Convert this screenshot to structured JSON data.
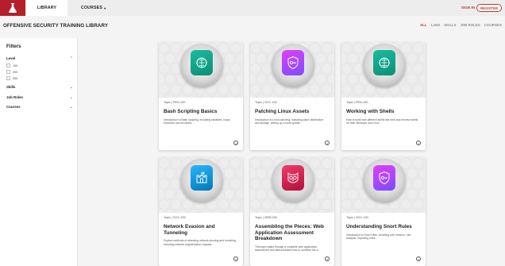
{
  "nav": {
    "library": "LIBRARY",
    "courses": "COURSES",
    "caret": "▾",
    "signin": "SIGN IN",
    "register": "REGISTER"
  },
  "page": {
    "title": "OFFENSIVE SECURITY TRAINING LIBRARY",
    "tabs": [
      "ALL",
      "LABS",
      "SKILLS",
      "JOB ROLES",
      "COURSES"
    ],
    "active_tab": "ALL"
  },
  "filters": {
    "title": "Filters",
    "level": "Level",
    "levels": [
      "100",
      "200",
      "300"
    ],
    "skills": "Skills",
    "job_roles": "Job Roles",
    "courses": "Courses"
  },
  "cards": [
    {
      "meta": "Topic | PEN-100",
      "title": "Bash Scripting Basics",
      "desc": "Introduction to Bash scripting, including variables, loops, branches and functions...",
      "badge_from": "#1abc9c",
      "badge_to": "#0e8e76",
      "icon": "brain-circuit-icon"
    },
    {
      "meta": "Topic | SOC-100",
      "title": "Patching Linux Assets",
      "desc": "Introduction to Linux patching, including patch distribution and storage, setting up a local update...",
      "badge_from": "#e040fb",
      "badge_to": "#7c4dff",
      "icon": "key-shield-icon"
    },
    {
      "meta": "Topic | PEN-100",
      "title": "Working with Shells",
      "desc": "How to work with different shells like bind and reverse shells on both Windows and Linux...",
      "badge_from": "#1abc9c",
      "badge_to": "#0e8e76",
      "icon": "brain-circuit-icon"
    },
    {
      "meta": "Topic | SOC-200",
      "title": "Network Evasion and Tunneling",
      "desc": "Explore methods of detecting network pivoting and tunneling, including network segmentation, bypass...",
      "badge_from": "#29b6f6",
      "badge_to": "#0277bd",
      "icon": "castle-icon"
    },
    {
      "meta": "Topic | WEB-200",
      "title": "Assembling the Pieces: Web Application Assessment Breakdown",
      "desc": "This topic walks through a complete web application assessment and demonstrates how to combine the a...",
      "badge_from": "#ef3b6b",
      "badge_to": "#b5103c",
      "icon": "owl-icon"
    },
    {
      "meta": "Topic | SOC-100",
      "title": "Understanding Snort Rules",
      "desc": "Introduction to Snort rules, including rule creation, rule analysis, importing rules...",
      "badge_from": "#e040fb",
      "badge_to": "#7c4dff",
      "icon": "key-shield-icon"
    }
  ]
}
